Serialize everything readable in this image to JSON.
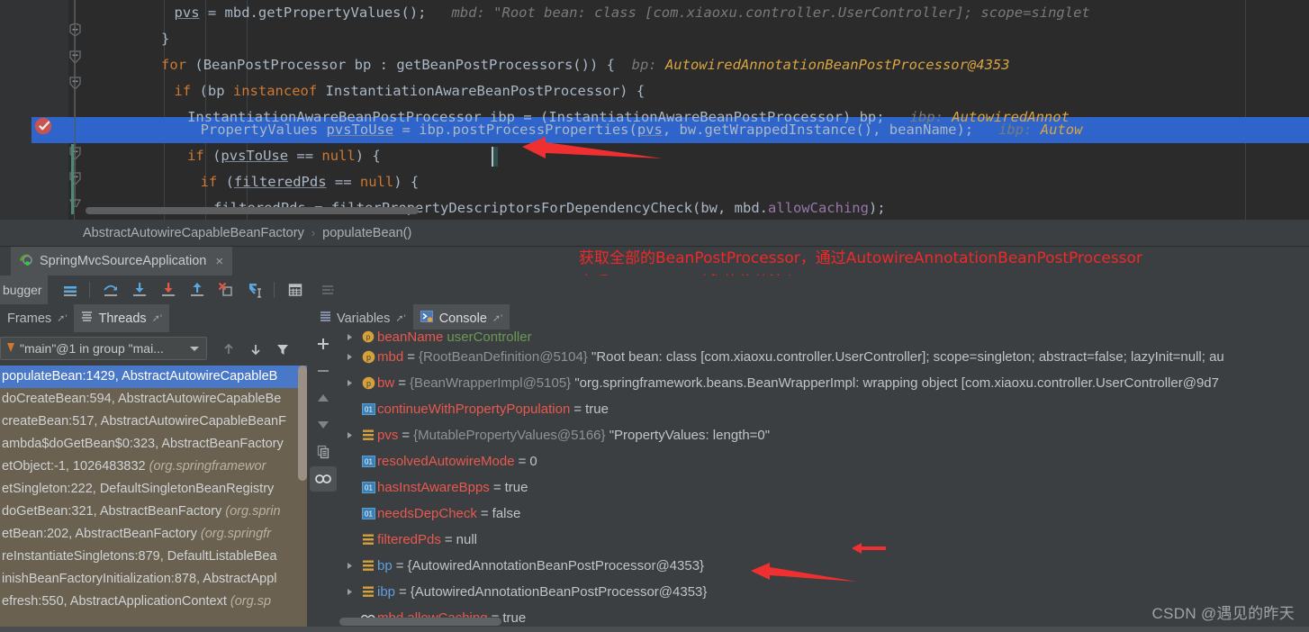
{
  "editor": {
    "code_lines": [
      {
        "indent": 14,
        "segments": [
          {
            "t": "pvs",
            "c": "und"
          },
          {
            "t": " = mbd.getPropertyValues();",
            "c": ""
          },
          {
            "t": "   mbd:",
            "c": "hintg"
          },
          {
            "t": " \"Root bean: class [com.xiaoxu.controller.UserController]; scope=singlet",
            "c": "hintg"
          }
        ]
      },
      {
        "indent": 12,
        "segments": [
          {
            "t": "}",
            "c": ""
          }
        ]
      },
      {
        "indent": 12,
        "segments": [
          {
            "t": "for",
            "c": "kw"
          },
          {
            "t": " (BeanPostProcessor bp : getBeanPostProcessors()) {",
            "c": ""
          },
          {
            "t": "  bp:",
            "c": "hintg"
          },
          {
            "t": " AutowiredAnnotationBeanPostProcessor@4353",
            "c": "hinto"
          }
        ]
      },
      {
        "indent": 14,
        "segments": [
          {
            "t": "if",
            "c": "kw"
          },
          {
            "t": " (bp ",
            "c": ""
          },
          {
            "t": "instanceof",
            "c": "kw"
          },
          {
            "t": " InstantiationAwareBeanPostProcessor) {",
            "c": ""
          }
        ]
      },
      {
        "indent": 16,
        "segments": [
          {
            "t": "InstantiationAwareBeanPostProcessor ibp = (InstantiationAwareBeanPostProcessor) bp;",
            "c": ""
          },
          {
            "t": "   ibp:",
            "c": "hintg"
          },
          {
            "t": " AutowiredAnnot",
            "c": "hinto"
          }
        ]
      },
      {
        "indent": 18,
        "segments": [
          {
            "t": "PropertyValues ",
            "c": ""
          },
          {
            "t": "pvsToUse",
            "c": "und"
          },
          {
            "t": " = ibp.postProcessProperties(",
            "c": ""
          },
          {
            "t": "pvs",
            "c": "und"
          },
          {
            "t": ", bw.getWrappedInstance(), beanName);",
            "c": ""
          },
          {
            "t": "   ibp:",
            "c": "hintg"
          },
          {
            "t": " Autow",
            "c": "hinto"
          }
        ]
      },
      {
        "indent": 16,
        "segments": [
          {
            "t": "if",
            "c": "kw"
          },
          {
            "t": " (",
            "c": ""
          },
          {
            "t": "pvsToUse",
            "c": "und"
          },
          {
            "t": " == ",
            "c": ""
          },
          {
            "t": "null",
            "c": "kw"
          },
          {
            "t": ") ",
            "c": ""
          },
          {
            "t": "{",
            "c": ""
          }
        ]
      },
      {
        "indent": 18,
        "segments": [
          {
            "t": "if",
            "c": "kw"
          },
          {
            "t": " (",
            "c": ""
          },
          {
            "t": "filteredPds",
            "c": "und"
          },
          {
            "t": " == ",
            "c": ""
          },
          {
            "t": "null",
            "c": "kw"
          },
          {
            "t": ") {",
            "c": ""
          }
        ]
      },
      {
        "indent": 20,
        "segments": [
          {
            "t": "filteredPds",
            "c": "und"
          },
          {
            "t": " = filterPropertyDescriptorsForDependencyCheck(bw, mbd.",
            "c": ""
          },
          {
            "t": "allowCaching",
            "c": "fld"
          },
          {
            "t": ");",
            "c": ""
          }
        ]
      }
    ],
    "highlighted_line_index": 5,
    "breakpoint": "breakpoint-verified-icon"
  },
  "breadcrumb": {
    "class_name": "AbstractAutowireCapableBeanFactory",
    "separator": "›",
    "method_name": "populateBean()"
  },
  "run_tab": {
    "icon": "spring-boot-icon",
    "title": "SpringMvcSourceApplication",
    "close": "×"
  },
  "annotation": {
    "line1": "获取全部的BeanPostProcessor，通过AutowireAnnotationBeanPostProcessor",
    "line2": "实现@Autowire对象的依赖注入",
    "color": "#ef2929"
  },
  "debug_toolbar": {
    "label": "bugger",
    "buttons": [
      {
        "name": "show-execution-point-icon",
        "title": "Show Execution Point"
      },
      {
        "name": "step-over-icon",
        "title": "Step Over"
      },
      {
        "name": "step-into-icon",
        "title": "Step Into"
      },
      {
        "name": "force-step-into-icon",
        "title": "Force Step Into"
      },
      {
        "name": "step-out-icon",
        "title": "Step Out"
      },
      {
        "name": "drop-frame-icon",
        "title": "Drop Frame"
      },
      {
        "name": "run-to-cursor-icon",
        "title": "Run to Cursor"
      },
      {
        "name": "evaluate-expression-icon",
        "title": "Evaluate Expression"
      },
      {
        "name": "trace-current-stream-icon",
        "title": "Trace Current Stream Chain"
      }
    ]
  },
  "frames_panel": {
    "tabs": [
      {
        "label": "Frames",
        "selected": true,
        "icon": ""
      },
      {
        "label": "Threads",
        "selected": false,
        "icon": "threads-icon"
      }
    ],
    "thread_selector": "\"main\"@1 in group \"mai...",
    "toolbar": [
      "arrow-up-icon",
      "arrow-down-icon",
      "filter-icon"
    ],
    "frames": [
      {
        "text": "populateBean:1429, AbstractAutowireCapableB",
        "pkg": "",
        "selected": true
      },
      {
        "text": "doCreateBean:594, AbstractAutowireCapableBe",
        "pkg": "",
        "selected": false
      },
      {
        "text": "createBean:517, AbstractAutowireCapableBeanF",
        "pkg": "",
        "selected": false
      },
      {
        "text": "ambda$doGetBean$0:323, AbstractBeanFactory",
        "pkg": "",
        "selected": false
      },
      {
        "text": "etObject:-1, 1026483832 ",
        "pkg": "(org.springframewor",
        "selected": false
      },
      {
        "text": "etSingleton:222, DefaultSingletonBeanRegistry",
        "pkg": "",
        "selected": false
      },
      {
        "text": "doGetBean:321, AbstractBeanFactory ",
        "pkg": "(org.sprin",
        "selected": false
      },
      {
        "text": "etBean:202, AbstractBeanFactory ",
        "pkg": "(org.springfr",
        "selected": false
      },
      {
        "text": "reInstantiateSingletons:879, DefaultListableBea",
        "pkg": "",
        "selected": false
      },
      {
        "text": "inishBeanFactoryInitialization:878, AbstractAppl",
        "pkg": "",
        "selected": false
      },
      {
        "text": "efresh:550, AbstractApplicationContext ",
        "pkg": "(org.sp",
        "selected": false
      }
    ],
    "side_buttons": [
      "plus-icon",
      "minus-icon",
      "up-icon",
      "down-icon",
      "copy-icon",
      "watches-icon"
    ]
  },
  "variables_panel": {
    "tabs": [
      {
        "label": "Variables",
        "icon": "variables-icon",
        "selected": false
      },
      {
        "label": "Console",
        "icon": "console-icon",
        "selected": true
      }
    ],
    "rows": [
      {
        "expandable": true,
        "icon": "p",
        "name": "beanName",
        "eq": "",
        "value": "userController",
        "cut": true
      },
      {
        "expandable": true,
        "icon": "p",
        "name": "mbd",
        "eq": "=",
        "ref": "{RootBeanDefinition@5104}",
        "value": "\"Root bean: class [com.xiaoxu.controller.UserController]; scope=singleton; abstract=false; lazyInit=null; au"
      },
      {
        "expandable": true,
        "icon": "p",
        "name": "bw",
        "eq": "=",
        "ref": "{BeanWrapperImpl@5105}",
        "value": "\"org.springframework.beans.BeanWrapperImpl: wrapping object [com.xiaoxu.controller.UserController@9d7"
      },
      {
        "expandable": false,
        "icon": "01",
        "name": "continueWithPropertyPopulation",
        "eq": "=",
        "ref": "",
        "value": "true"
      },
      {
        "expandable": true,
        "icon": "list",
        "name": "pvs",
        "eq": "=",
        "ref": "{MutablePropertyValues@5166}",
        "value": "\"PropertyValues: length=0\""
      },
      {
        "expandable": false,
        "icon": "01",
        "name": "resolvedAutowireMode",
        "eq": "=",
        "ref": "",
        "value": "0"
      },
      {
        "expandable": false,
        "icon": "01",
        "name": "hasInstAwareBpps",
        "eq": "=",
        "ref": "",
        "value": "true"
      },
      {
        "expandable": false,
        "icon": "01",
        "name": "needsDepCheck",
        "eq": "=",
        "ref": "",
        "value": "false"
      },
      {
        "expandable": false,
        "icon": "list",
        "name": "filteredPds",
        "eq": "=",
        "ref": "",
        "value": "null"
      },
      {
        "expandable": true,
        "icon": "list",
        "name": "bp",
        "blue": true,
        "eq": "=",
        "ref": "{AutowiredAnnotationBeanPostProcessor@4353}",
        "value": ""
      },
      {
        "expandable": true,
        "icon": "list",
        "name": "ibp",
        "blue": true,
        "eq": "=",
        "ref": "{AutowiredAnnotationBeanPostProcessor@4353}",
        "value": ""
      },
      {
        "expandable": false,
        "icon": "watch",
        "name": "mbd.allowCaching",
        "eq": "=",
        "ref": "",
        "value": "true"
      }
    ]
  },
  "watermark": "CSDN @遇见的昨天",
  "colors": {
    "editor_bg": "#2b2b2b",
    "panel_bg": "#3c3f41",
    "selection_blue": "#2f65ca",
    "frames_bg": "#6b6150",
    "annotation_red": "#ef2929",
    "var_name_red": "#e8584f",
    "keyword_orange": "#cc7832"
  }
}
